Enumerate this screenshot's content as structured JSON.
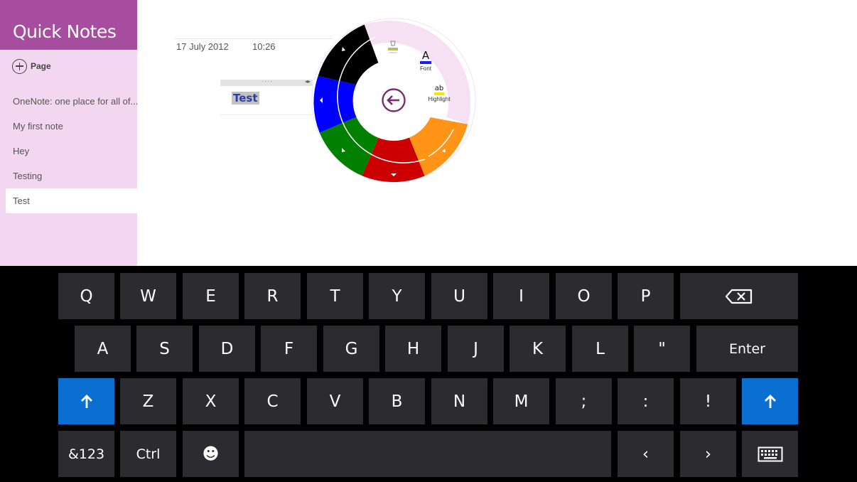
{
  "app": {
    "title": "Quick Notes",
    "add_page_label": "Page",
    "accent": "#a64d9f",
    "sidebar_bg": "#f3d6ef"
  },
  "pages": [
    {
      "label": "OneNote: one place for all of..."
    },
    {
      "label": "My first note"
    },
    {
      "label": "Hey"
    },
    {
      "label": "Testing"
    },
    {
      "label": "Test",
      "selected": true
    }
  ],
  "note": {
    "date": "17 July 2012",
    "time": "10:26",
    "text": "Test",
    "container_handle_dots": "····"
  },
  "radial_menu": {
    "back_icon": "back-arrow-icon",
    "font_glyph": "A",
    "font_label": "Font",
    "highlight_glyph": "ab",
    "highlight_label": "Highlight",
    "colors": {
      "black": "#000000",
      "blue": "#0000ff",
      "green": "#008000",
      "red": "#cc0000",
      "orange": "#ff9416",
      "ring": "#f6e0f3",
      "back": "#7a2d74"
    }
  },
  "keyboard": {
    "rows": [
      [
        "Q",
        "W",
        "E",
        "R",
        "T",
        "Y",
        "U",
        "I",
        "O",
        "P"
      ],
      [
        "A",
        "S",
        "D",
        "F",
        "G",
        "H",
        "J",
        "K",
        "L",
        "\""
      ],
      [
        "Z",
        "X",
        "C",
        "V",
        "B",
        "N",
        "M",
        ";",
        ":",
        "!"
      ]
    ],
    "enter_label": "Enter",
    "symbols_label": "&123",
    "ctrl_label": "Ctrl",
    "emoji_glyph": "☻",
    "left_glyph": "‹",
    "right_glyph": "›",
    "key_color": "#2b2b30",
    "shift_color": "#0a6fd0"
  }
}
